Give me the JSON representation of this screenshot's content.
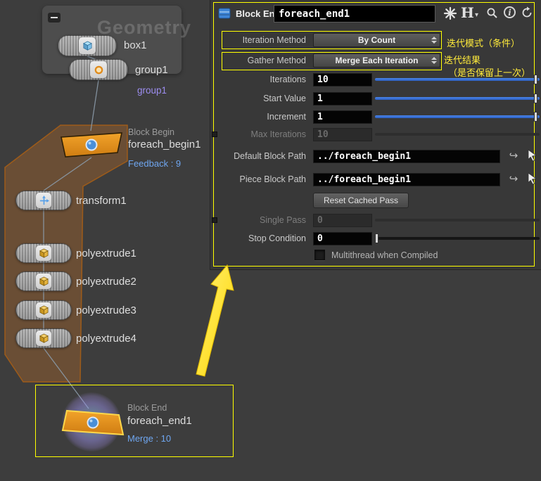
{
  "network": {
    "watermark": "Geometry",
    "nodes": {
      "box1": {
        "label": "box1"
      },
      "group1": {
        "label": "group1",
        "badge": "group1"
      },
      "foreach_begin1": {
        "type_label": "Block Begin",
        "label": "foreach_begin1",
        "info": "Feedback : 9"
      },
      "transform1": {
        "label": "transform1"
      },
      "polyextrude1": {
        "label": "polyextrude1"
      },
      "polyextrude2": {
        "label": "polyextrude2"
      },
      "polyextrude3": {
        "label": "polyextrude3"
      },
      "polyextrude4": {
        "label": "polyextrude4"
      },
      "foreach_end1": {
        "type_label": "Block End",
        "label": "foreach_end1",
        "info": "Merge : 10"
      }
    }
  },
  "params": {
    "header": {
      "type_label": "Block End",
      "node_name": "foreach_end1"
    },
    "iteration_method": {
      "label": "Iteration Method",
      "value": "By Count"
    },
    "gather_method": {
      "label": "Gather Method",
      "value": "Merge Each Iteration"
    },
    "iterations": {
      "label": "Iterations",
      "value": "10"
    },
    "start_value": {
      "label": "Start Value",
      "value": "1"
    },
    "increment": {
      "label": "Increment",
      "value": "1"
    },
    "max_iterations": {
      "label": "Max Iterations",
      "value": "10"
    },
    "default_block_path": {
      "label": "Default Block Path",
      "value": "../foreach_begin1"
    },
    "piece_block_path": {
      "label": "Piece Block Path",
      "value": "../foreach_begin1"
    },
    "reset_cached_pass": {
      "label": "Reset Cached Pass"
    },
    "single_pass": {
      "label": "Single Pass",
      "value": "0"
    },
    "stop_condition": {
      "label": "Stop Condition",
      "value": "0"
    },
    "multithread": {
      "label": "Multithread when Compiled"
    }
  },
  "annotations": {
    "iteration_mode_note": "迭代模式（条件）",
    "gather_note_line1": "迭代结果",
    "gather_note_line2": "（是否保留上一次）"
  },
  "icons": {
    "info_glyph": "i",
    "houdini_logo_glyph": "H",
    "dropdown_caret": "▾",
    "jump_arrow": "↪"
  },
  "colors": {
    "annotation_yellow": "#ffff00",
    "slider_blue": "#2e6bd6",
    "selection_orange": "#d6741c",
    "info_blue": "#6fa6f0"
  }
}
